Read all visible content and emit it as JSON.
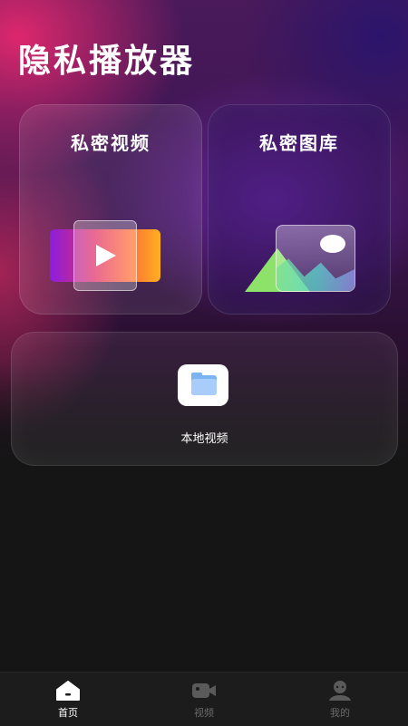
{
  "page": {
    "title": "隐私播放器"
  },
  "cards": {
    "private_video": {
      "label": "私密视频",
      "icon": "play-icon"
    },
    "private_gallery": {
      "label": "私密图库",
      "icon": "image-icon"
    },
    "local_video": {
      "label": "本地视频",
      "icon": "folder-icon"
    }
  },
  "tabbar": {
    "items": [
      {
        "label": "首页",
        "icon": "home-icon",
        "active": true
      },
      {
        "label": "视频",
        "icon": "video-camera-icon",
        "active": false
      },
      {
        "label": "我的",
        "icon": "user-icon",
        "active": false
      }
    ]
  },
  "colors": {
    "active_tab": "#ffffff",
    "inactive_tab": "#6a6a6a",
    "background": "#151515",
    "folder_blue": "#7ab2f2"
  }
}
